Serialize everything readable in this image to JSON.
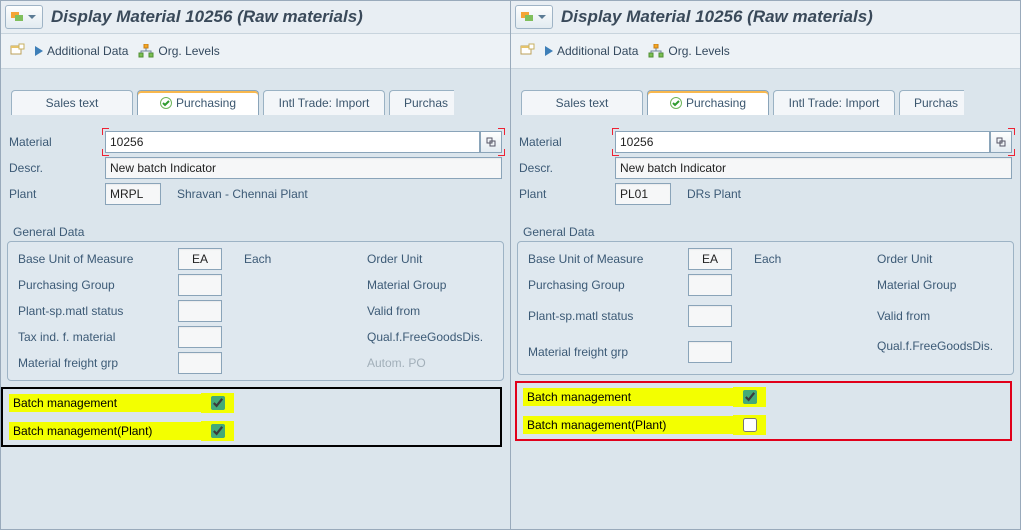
{
  "left": {
    "title": "Display Material 10256 (Raw materials)",
    "toolbar": {
      "additional_data": "Additional Data",
      "org_levels": "Org. Levels"
    },
    "tabs": {
      "sales_text": "Sales text",
      "purchasing": "Purchasing",
      "intl_trade": "Intl Trade: Import",
      "purchase_clip": "Purchas"
    },
    "fields": {
      "material_label": "Material",
      "material_value": "10256",
      "descr_label": "Descr.",
      "descr_value": "New batch Indicator",
      "plant_label": "Plant",
      "plant_value": "MRPL",
      "plant_name": "Shravan - Chennai Plant"
    },
    "general": {
      "group_title": "General Data",
      "bum_label": "Base Unit of Measure",
      "bum_value": "EA",
      "bum_text": "Each",
      "purch_grp": "Purchasing Group",
      "plantsp": "Plant-sp.matl status",
      "taxind": "Tax ind. f. material",
      "matfr": "Material freight grp",
      "right_order_unit": "Order Unit",
      "right_mat_group": "Material Group",
      "right_valid_from": "Valid from",
      "right_qual": "Qual.f.FreeGoodsDis.",
      "right_autopo": "Autom. PO",
      "batch_mgmt": "Batch management",
      "batch_mgmt_plant": "Batch management(Plant)",
      "batch_mgmt_checked": true,
      "batch_mgmt_plant_checked": true
    }
  },
  "right": {
    "title": "Display Material 10256 (Raw materials)",
    "toolbar": {
      "additional_data": "Additional Data",
      "org_levels": "Org. Levels"
    },
    "tabs": {
      "sales_text": "Sales text",
      "purchasing": "Purchasing",
      "intl_trade": "Intl Trade: Import",
      "purchase_clip": "Purchas"
    },
    "fields": {
      "material_label": "Material",
      "material_value": "10256",
      "descr_label": "Descr.",
      "descr_value": "New batch Indicator",
      "plant_label": "Plant",
      "plant_value": "PL01",
      "plant_name": "DRs Plant"
    },
    "general": {
      "group_title": "General Data",
      "bum_label": "Base Unit of Measure",
      "bum_value": "EA",
      "bum_text": "Each",
      "purch_grp": "Purchasing Group",
      "plantsp": "Plant-sp.matl status",
      "matfr": "Material freight grp",
      "right_order_unit": "Order Unit",
      "right_mat_group": "Material Group",
      "right_valid_from": "Valid from",
      "right_qual": "Qual.f.FreeGoodsDis.",
      "batch_mgmt": "Batch management",
      "batch_mgmt_plant": "Batch management(Plant)",
      "batch_mgmt_checked": true,
      "batch_mgmt_plant_checked": false
    }
  }
}
